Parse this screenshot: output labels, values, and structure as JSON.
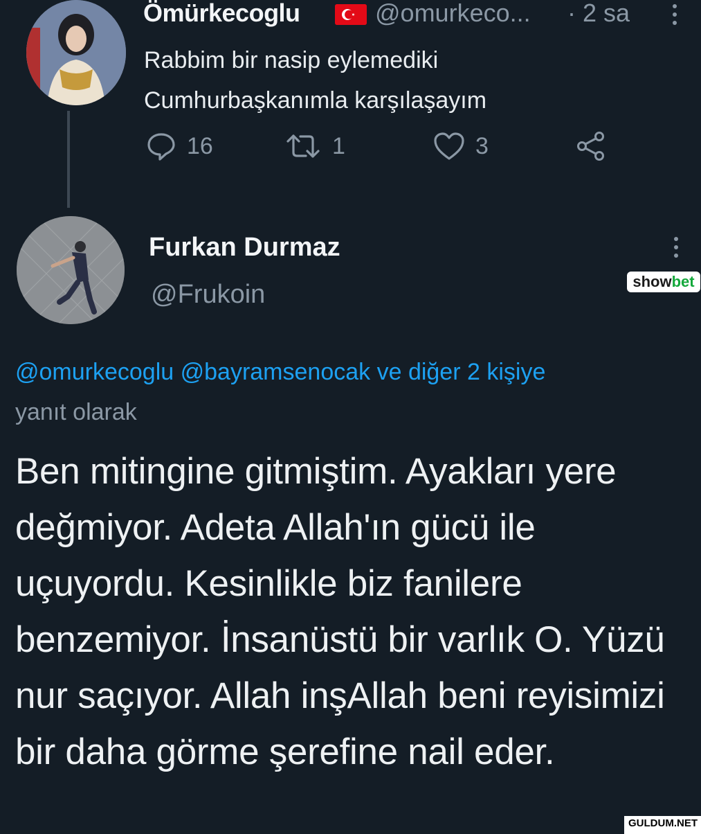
{
  "parent_tweet": {
    "display_name": "Ömürkecoglu",
    "flag_icon": "turkey-flag-icon",
    "handle": "@omurkeco...",
    "time": "· 2 sa",
    "text": "Rabbim bir nasip eylemediki Cumhurbaşkanımla karşılaşayım",
    "replies": "16",
    "retweets": "1",
    "likes": "3"
  },
  "reply_tweet": {
    "display_name": "Furkan Durmaz",
    "handle": "@Frukoin",
    "reply_to_mentions": "@omurkecoglu @bayramsenocak ve diğer 2 kişiye",
    "reply_to_suffix": "yanıt olarak",
    "text": "Ben mitingine gitmiştim. Ayakları yere değmiyor. Adeta Allah'ın gücü ile uçuyordu. Kesinlikle biz fanilere benzemiyor. İnsanüstü bir varlık O. Yüzü nur saçıyor. Allah inşAllah beni reyisimizi bir daha görme şerefine nail eder."
  },
  "overlay": {
    "showbet_text_a": "show",
    "showbet_text_b": "bet",
    "watermark": "GULDUM.NET"
  },
  "colors": {
    "background": "#141d26",
    "link": "#1da1f2",
    "muted": "#8b98a5"
  }
}
